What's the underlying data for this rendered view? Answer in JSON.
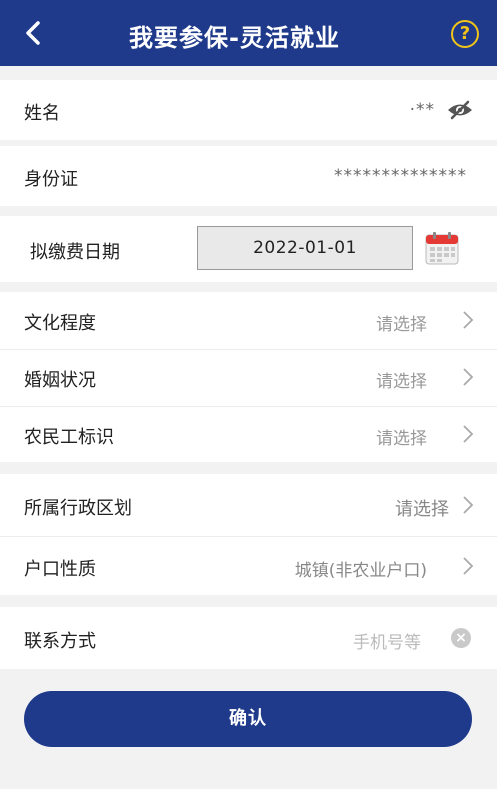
{
  "header": {
    "title": "我要参保-灵活就业",
    "back_icon": "chevron-left-icon",
    "help_icon": "question-circle-icon",
    "help_glyph": "?",
    "color": "#1f3a8a",
    "help_color": "#f0c419"
  },
  "form": {
    "name": {
      "label": "姓名",
      "value": "·**"
    },
    "id_card": {
      "label": "身份证",
      "value": "**************"
    },
    "pay_date": {
      "label": "拟缴费日期",
      "value": "2022-01-01"
    },
    "education": {
      "label": "文化程度",
      "value": "请选择"
    },
    "marital": {
      "label": "婚姻状况",
      "value": "请选择"
    },
    "migrant": {
      "label": "农民工标识",
      "value": "请选择"
    },
    "region": {
      "label": "所属行政区划",
      "value": "请选择"
    },
    "hukou": {
      "label": "户口性质",
      "value": "城镇(非农业户口)"
    },
    "contact": {
      "label": "联系方式",
      "placeholder": "手机号等"
    }
  },
  "confirm_label": "确认"
}
